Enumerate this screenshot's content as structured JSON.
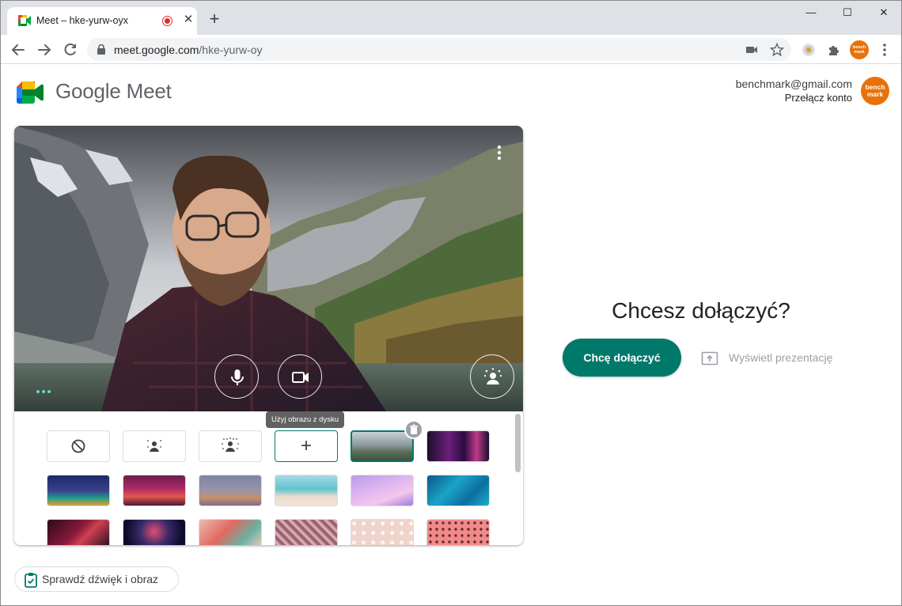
{
  "browser": {
    "tab_title": "Meet – hke-yurw-oyx",
    "new_tab_symbol": "+",
    "tab_close_symbol": "✕",
    "url_host": "meet.google.com",
    "url_path": "/hke-yurw-oy",
    "window_controls": [
      "—",
      "☐",
      "✕"
    ],
    "icons": [
      "back-arrow-icon",
      "forward-arrow-icon",
      "reload-icon",
      "lock-icon",
      "camera-icon",
      "star-icon",
      "extension-icon",
      "puzzle-icon",
      "profile-avatar",
      "menu-kebab-icon"
    ]
  },
  "header": {
    "logo_text": "Google Meet",
    "account_email": "benchmark@gmail.com",
    "switch_account": "Przełącz konto",
    "avatar_text_line1": "bench",
    "avatar_text_line2": "mark"
  },
  "preview": {
    "controls": [
      "microphone-icon",
      "camera-icon",
      "background-effects-icon"
    ],
    "menu": "more-vert-icon"
  },
  "backgrounds": {
    "tooltip": "Użyj obrazu z dysku",
    "add_symbol": "+",
    "rows": [
      [
        "no-effect",
        "slight-blur",
        "blur",
        "add-image",
        "mountain-lake (selected)",
        "neon-room"
      ],
      [
        "night-lanterns",
        "party-lights",
        "gradient-sunset",
        "beach",
        "clouds-pink",
        "water-blue"
      ],
      [
        "nebula",
        "fireworks",
        "blossoms",
        "flowers",
        "pink-dots",
        "pink-pattern"
      ]
    ]
  },
  "join": {
    "title": "Chcesz dołączyć?",
    "join_button": "Chcę dołączyć",
    "present_button": "Wyświetl prezentację"
  },
  "footer": {
    "check_button": "Sprawdź dźwięk i obraz"
  },
  "colors": {
    "accent": "#00796b",
    "tabstrip": "#dee1e6",
    "avatar": "#e8710a"
  }
}
